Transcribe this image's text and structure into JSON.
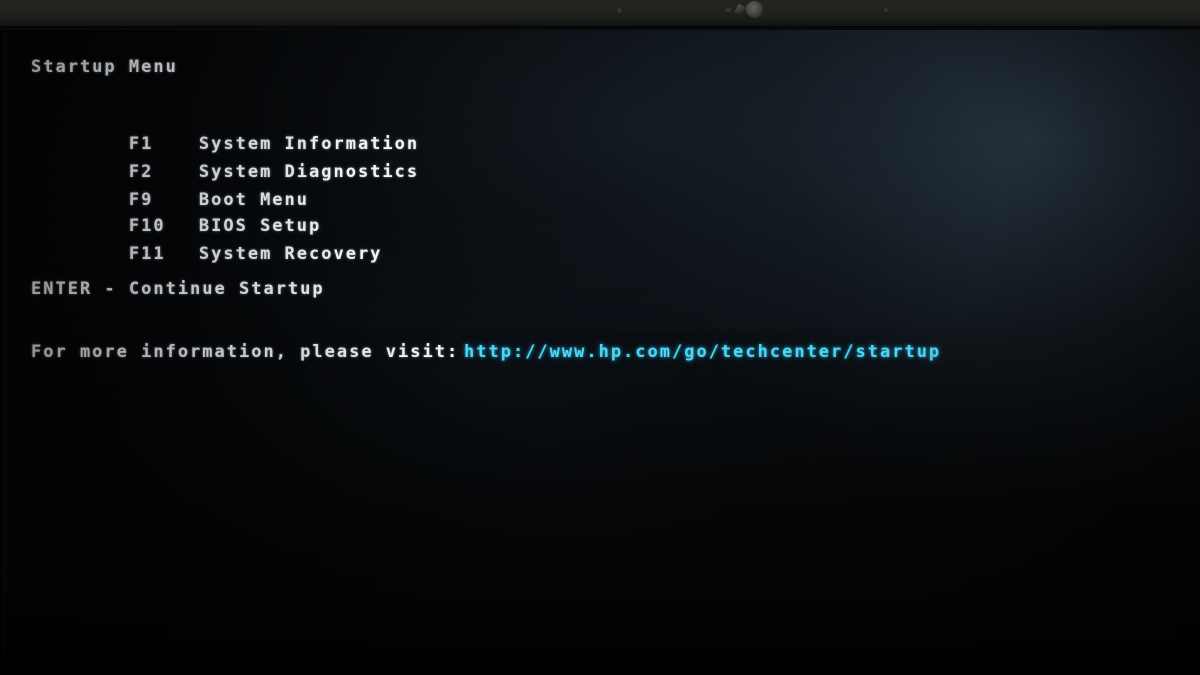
{
  "screen": {
    "title": "Startup Menu",
    "menu_items": [
      {
        "key": "F1",
        "label": "System Information"
      },
      {
        "key": "F2",
        "label": "System Diagnostics"
      },
      {
        "key": "F9",
        "label": "Boot Menu"
      },
      {
        "key": "F10",
        "label": "BIOS Setup"
      },
      {
        "key": "F11",
        "label": "System Recovery"
      }
    ],
    "continue_line": "ENTER - Continue Startup",
    "info_prompt": "For more information, please visit:",
    "info_url": "http://www.hp.com/go/techcenter/startup",
    "colors": {
      "text": "#f2f4f6",
      "link": "#49d8f7",
      "background": "#040506",
      "bezel": "#1e211c"
    }
  },
  "hardware": {
    "bezel_label": "laptop-top-bezel",
    "webcam_label": "webcam-lens",
    "microphone_label": "microphone-pinhole"
  }
}
